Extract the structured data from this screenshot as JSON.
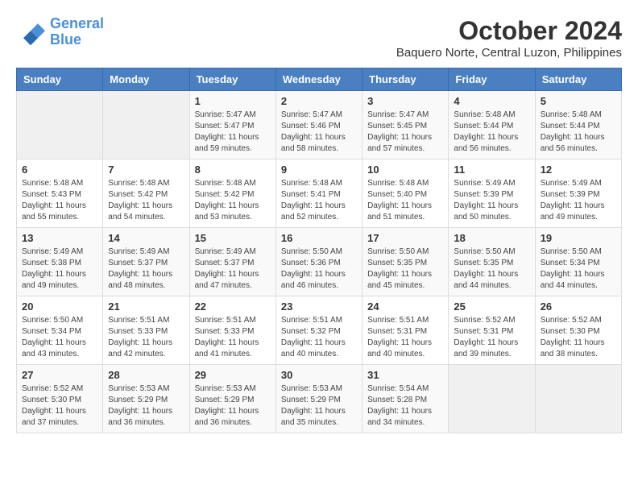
{
  "header": {
    "logo_line1": "General",
    "logo_line2": "Blue",
    "month": "October 2024",
    "location": "Baquero Norte, Central Luzon, Philippines"
  },
  "days_of_week": [
    "Sunday",
    "Monday",
    "Tuesday",
    "Wednesday",
    "Thursday",
    "Friday",
    "Saturday"
  ],
  "weeks": [
    [
      {
        "day": "",
        "info": ""
      },
      {
        "day": "",
        "info": ""
      },
      {
        "day": "1",
        "info": "Sunrise: 5:47 AM\nSunset: 5:47 PM\nDaylight: 11 hours and 59 minutes."
      },
      {
        "day": "2",
        "info": "Sunrise: 5:47 AM\nSunset: 5:46 PM\nDaylight: 11 hours and 58 minutes."
      },
      {
        "day": "3",
        "info": "Sunrise: 5:47 AM\nSunset: 5:45 PM\nDaylight: 11 hours and 57 minutes."
      },
      {
        "day": "4",
        "info": "Sunrise: 5:48 AM\nSunset: 5:44 PM\nDaylight: 11 hours and 56 minutes."
      },
      {
        "day": "5",
        "info": "Sunrise: 5:48 AM\nSunset: 5:44 PM\nDaylight: 11 hours and 56 minutes."
      }
    ],
    [
      {
        "day": "6",
        "info": "Sunrise: 5:48 AM\nSunset: 5:43 PM\nDaylight: 11 hours and 55 minutes."
      },
      {
        "day": "7",
        "info": "Sunrise: 5:48 AM\nSunset: 5:42 PM\nDaylight: 11 hours and 54 minutes."
      },
      {
        "day": "8",
        "info": "Sunrise: 5:48 AM\nSunset: 5:42 PM\nDaylight: 11 hours and 53 minutes."
      },
      {
        "day": "9",
        "info": "Sunrise: 5:48 AM\nSunset: 5:41 PM\nDaylight: 11 hours and 52 minutes."
      },
      {
        "day": "10",
        "info": "Sunrise: 5:48 AM\nSunset: 5:40 PM\nDaylight: 11 hours and 51 minutes."
      },
      {
        "day": "11",
        "info": "Sunrise: 5:49 AM\nSunset: 5:39 PM\nDaylight: 11 hours and 50 minutes."
      },
      {
        "day": "12",
        "info": "Sunrise: 5:49 AM\nSunset: 5:39 PM\nDaylight: 11 hours and 49 minutes."
      }
    ],
    [
      {
        "day": "13",
        "info": "Sunrise: 5:49 AM\nSunset: 5:38 PM\nDaylight: 11 hours and 49 minutes."
      },
      {
        "day": "14",
        "info": "Sunrise: 5:49 AM\nSunset: 5:37 PM\nDaylight: 11 hours and 48 minutes."
      },
      {
        "day": "15",
        "info": "Sunrise: 5:49 AM\nSunset: 5:37 PM\nDaylight: 11 hours and 47 minutes."
      },
      {
        "day": "16",
        "info": "Sunrise: 5:50 AM\nSunset: 5:36 PM\nDaylight: 11 hours and 46 minutes."
      },
      {
        "day": "17",
        "info": "Sunrise: 5:50 AM\nSunset: 5:35 PM\nDaylight: 11 hours and 45 minutes."
      },
      {
        "day": "18",
        "info": "Sunrise: 5:50 AM\nSunset: 5:35 PM\nDaylight: 11 hours and 44 minutes."
      },
      {
        "day": "19",
        "info": "Sunrise: 5:50 AM\nSunset: 5:34 PM\nDaylight: 11 hours and 44 minutes."
      }
    ],
    [
      {
        "day": "20",
        "info": "Sunrise: 5:50 AM\nSunset: 5:34 PM\nDaylight: 11 hours and 43 minutes."
      },
      {
        "day": "21",
        "info": "Sunrise: 5:51 AM\nSunset: 5:33 PM\nDaylight: 11 hours and 42 minutes."
      },
      {
        "day": "22",
        "info": "Sunrise: 5:51 AM\nSunset: 5:33 PM\nDaylight: 11 hours and 41 minutes."
      },
      {
        "day": "23",
        "info": "Sunrise: 5:51 AM\nSunset: 5:32 PM\nDaylight: 11 hours and 40 minutes."
      },
      {
        "day": "24",
        "info": "Sunrise: 5:51 AM\nSunset: 5:31 PM\nDaylight: 11 hours and 40 minutes."
      },
      {
        "day": "25",
        "info": "Sunrise: 5:52 AM\nSunset: 5:31 PM\nDaylight: 11 hours and 39 minutes."
      },
      {
        "day": "26",
        "info": "Sunrise: 5:52 AM\nSunset: 5:30 PM\nDaylight: 11 hours and 38 minutes."
      }
    ],
    [
      {
        "day": "27",
        "info": "Sunrise: 5:52 AM\nSunset: 5:30 PM\nDaylight: 11 hours and 37 minutes."
      },
      {
        "day": "28",
        "info": "Sunrise: 5:53 AM\nSunset: 5:29 PM\nDaylight: 11 hours and 36 minutes."
      },
      {
        "day": "29",
        "info": "Sunrise: 5:53 AM\nSunset: 5:29 PM\nDaylight: 11 hours and 36 minutes."
      },
      {
        "day": "30",
        "info": "Sunrise: 5:53 AM\nSunset: 5:29 PM\nDaylight: 11 hours and 35 minutes."
      },
      {
        "day": "31",
        "info": "Sunrise: 5:54 AM\nSunset: 5:28 PM\nDaylight: 11 hours and 34 minutes."
      },
      {
        "day": "",
        "info": ""
      },
      {
        "day": "",
        "info": ""
      }
    ]
  ]
}
